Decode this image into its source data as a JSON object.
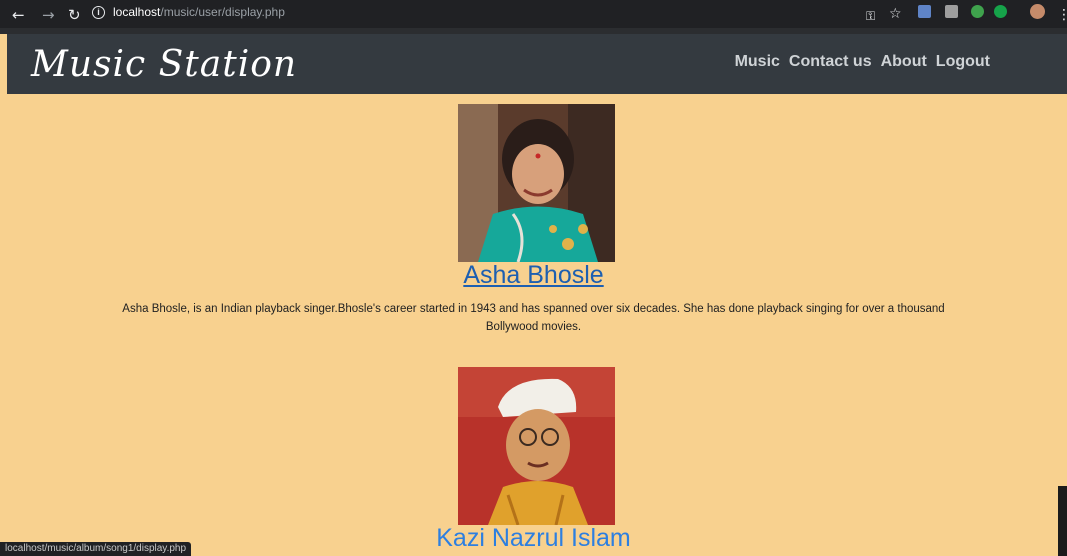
{
  "browser": {
    "url_host": "localhost",
    "url_path": "/music/user/display.php",
    "status_url": "localhost/music/album/song1/display.php"
  },
  "site": {
    "brand": "Music Station",
    "nav": [
      "Music",
      "Contact us",
      "About",
      "Logout"
    ]
  },
  "artists": [
    {
      "name": "Asha Bhosle",
      "description": "Asha Bhosle, is an Indian playback singer.Bhosle's career started in 1943 and has spanned over six decades. She has done playback singing for over a thousand Bollywood movies."
    },
    {
      "name": "Kazi Nazrul Islam"
    }
  ],
  "colors": {
    "page_bg": "#f8d18f",
    "navbar_bg": "#343a40",
    "link": "#1d5fb1"
  }
}
